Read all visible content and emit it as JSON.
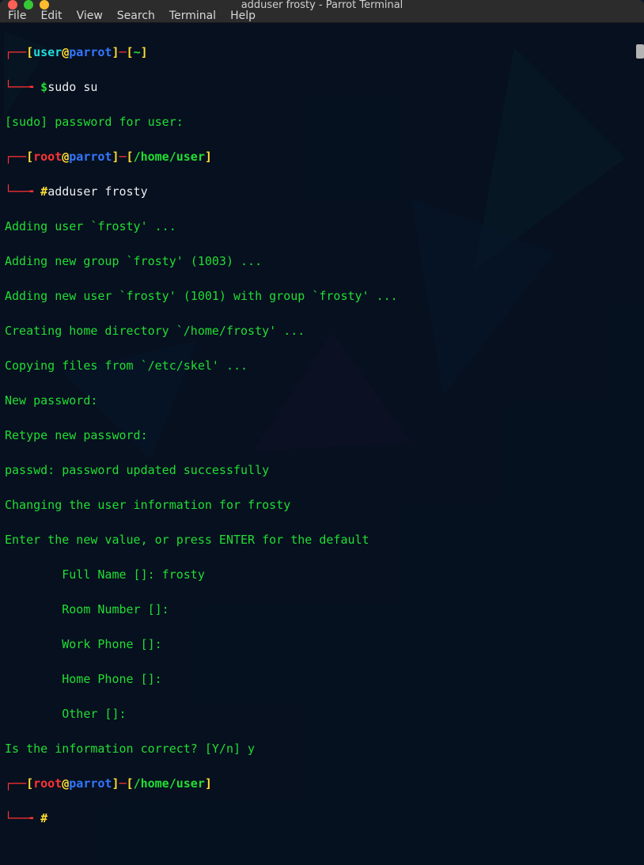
{
  "window": {
    "title": "adduser frosty - Parrot Terminal"
  },
  "menu": {
    "file": "File",
    "edit": "Edit",
    "view": "View",
    "search": "Search",
    "terminal": "Terminal",
    "help": "Help"
  },
  "prompt1": {
    "bracket_l1": "[",
    "user": "user",
    "at": "@",
    "host": "parrot",
    "bracket_r1": "]",
    "dash": "─",
    "bracket_l2": "[",
    "path": "~",
    "bracket_r2": "]",
    "corner_top": "┌──",
    "corner_bottom": "└──╼ ",
    "dollar": "$",
    "cmd": "sudo su"
  },
  "sudo_line": "[sudo] password for user:",
  "prompt2": {
    "bracket_l1": "[",
    "user": "root",
    "at": "@",
    "host": "parrot",
    "bracket_r1": "]",
    "dash": "─",
    "bracket_l2": "[",
    "path": "/home/user",
    "bracket_r2": "]",
    "corner_top": "┌──",
    "corner_bottom": "└──╼ ",
    "hash": "#",
    "cmd": "adduser frosty"
  },
  "output": {
    "l1": "Adding user `frosty' ...",
    "l2": "Adding new group `frosty' (1003) ...",
    "l3": "Adding new user `frosty' (1001) with group `frosty' ...",
    "l4": "Creating home directory `/home/frosty' ...",
    "l5": "Copying files from `/etc/skel' ...",
    "l6": "New password:",
    "l7": "Retype new password:",
    "l8": "passwd: password updated successfully",
    "l9": "Changing the user information for frosty",
    "l10": "Enter the new value, or press ENTER for the default",
    "l11": "        Full Name []: frosty",
    "l12": "        Room Number []: ",
    "l13": "        Work Phone []: ",
    "l14": "        Home Phone []: ",
    "l15": "        Other []: ",
    "l16": "Is the information correct? [Y/n] y"
  },
  "prompt3": {
    "bracket_l1": "[",
    "user": "root",
    "at": "@",
    "host": "parrot",
    "bracket_r1": "]",
    "dash": "─",
    "bracket_l2": "[",
    "path": "/home/user",
    "bracket_r2": "]",
    "corner_top": "┌──",
    "corner_bottom": "└──╼ ",
    "hash": "#"
  }
}
